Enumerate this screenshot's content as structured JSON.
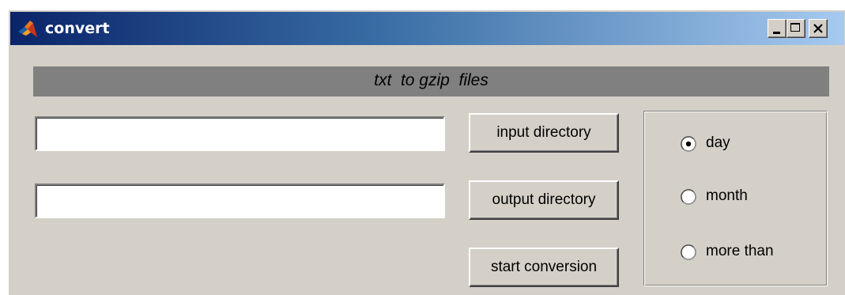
{
  "window": {
    "title": "convert",
    "controls": {
      "minimize_icon": "minimize-icon",
      "maximize_icon": "maximize-icon",
      "close_icon": "close-icon"
    },
    "title_gradient": [
      "#0a246a",
      "#3a6ea5",
      "#a6caf0"
    ]
  },
  "banner": {
    "text": "txt  to gzip  files",
    "background": "#808080"
  },
  "inputs": {
    "input_directory_value": "",
    "output_directory_value": ""
  },
  "buttons": {
    "input_directory": "input directory",
    "output_directory": "output directory",
    "start_conversion": "start conversion"
  },
  "radio_group": {
    "options": [
      {
        "label": "day",
        "selected": true
      },
      {
        "label": "month",
        "selected": false
      },
      {
        "label": "more than",
        "selected": false
      }
    ]
  }
}
